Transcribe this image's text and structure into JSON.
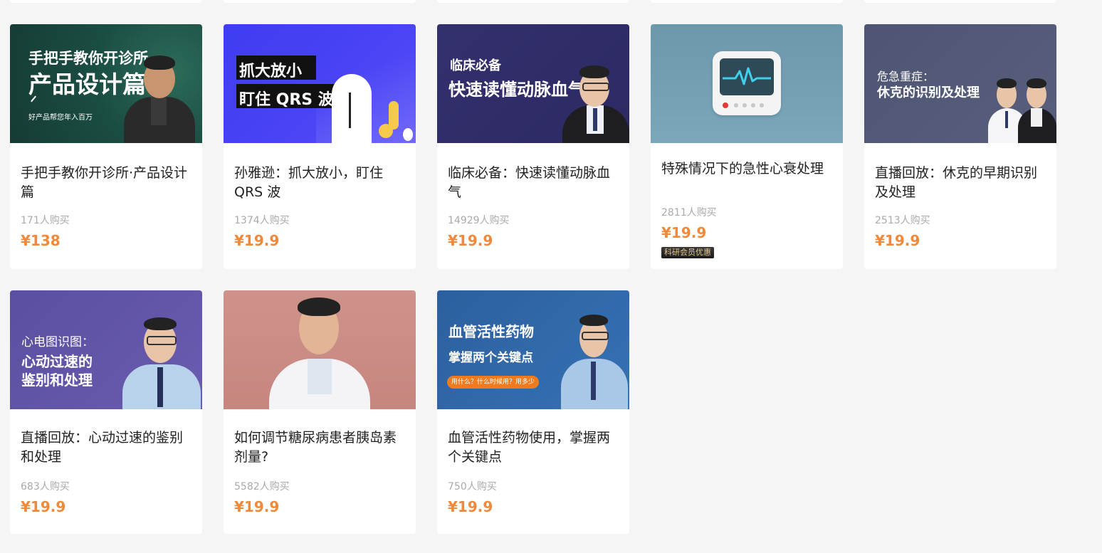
{
  "courses": [
    {
      "title": "手把手教你开诊所·产品设计篇",
      "buyers": "171人购买",
      "price": "¥138",
      "thumb": {
        "line1": "手把手教你开诊所",
        "line2": "产品设计篇",
        "tagline": "好产品帮您年入百万"
      }
    },
    {
      "title": "孙雅逊：抓大放小，盯住QRS 波",
      "buyers": "1374人购买",
      "price": "¥19.9",
      "thumb": {
        "line1": "抓大放小",
        "line2": "盯住 QRS 波"
      }
    },
    {
      "title": "临床必备：快速读懂动脉血气",
      "buyers": "14929人购买",
      "price": "¥19.9",
      "thumb": {
        "line1": "临床必备",
        "line2": "快速读懂动脉血气"
      }
    },
    {
      "title": "特殊情况下的急性心衰处理",
      "buyers": "2811人购买",
      "price": "¥19.9",
      "badge": "科研会员优惠"
    },
    {
      "title": "直播回放：休克的早期识别及处理",
      "buyers": "2513人购买",
      "price": "¥19.9",
      "thumb": {
        "line1": "危急重症：",
        "line2": "休克的识别及处理"
      }
    },
    {
      "title": "直播回放：心动过速的鉴别和处理",
      "buyers": "683人购买",
      "price": "¥19.9",
      "thumb": {
        "line1": "心电图识图：",
        "line2": "心动过速的",
        "line3": "鉴别和处理"
      }
    },
    {
      "title": "如何调节糖尿病患者胰岛素剂量?",
      "buyers": "5582人购买",
      "price": "¥19.9"
    },
    {
      "title": "血管活性药物使用，掌握两个关键点",
      "buyers": "750人购买",
      "price": "¥19.9",
      "thumb": {
        "line1": "血管活性药物",
        "line2": "掌握两个关键点",
        "pill": "用什么？什么时候用？用多少"
      }
    }
  ],
  "colors": {
    "price": "#f08a3a",
    "buyers": "#aaaaaa",
    "background": "#f5f5f5"
  }
}
